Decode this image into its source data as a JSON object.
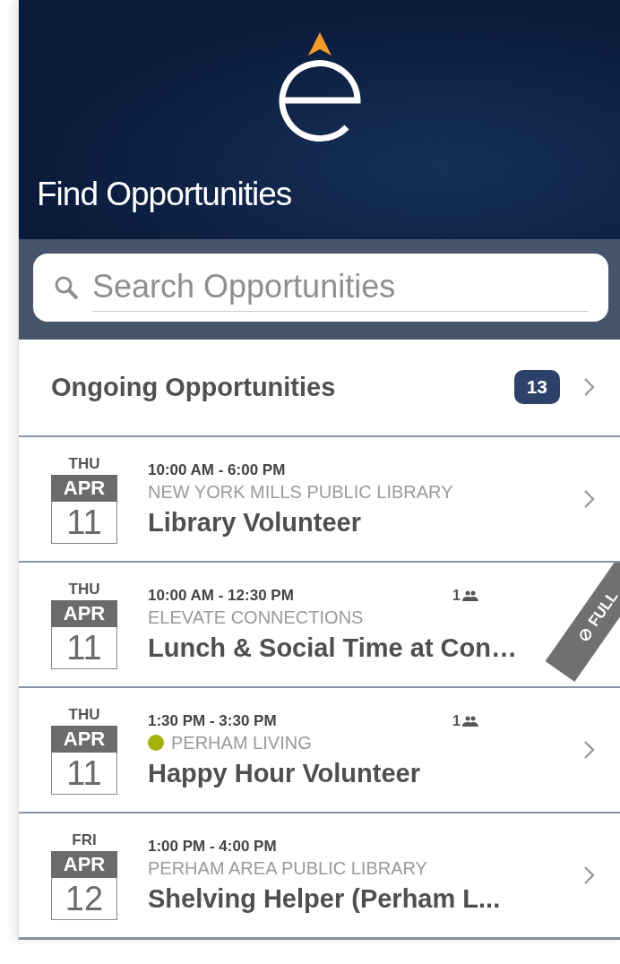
{
  "header": {
    "title": "Find Opportunities"
  },
  "search": {
    "placeholder": "Search Opportunities"
  },
  "ongoing": {
    "label": "Ongoing Opportunities",
    "count": "13"
  },
  "events": [
    {
      "day": "THU",
      "month": "APR",
      "date": "11",
      "time": "10:00 AM - 6:00 PM",
      "organization": "NEW YORK MILLS PUBLIC LIBRARY",
      "title": "Library Volunteer",
      "full": false
    },
    {
      "day": "THU",
      "month": "APR",
      "date": "11",
      "time": "10:00 AM - 12:30 PM",
      "attendees": "1",
      "organization": "ELEVATE CONNECTIONS",
      "title": "Lunch & Social Time at Con…",
      "full": true,
      "full_label": "FULL"
    },
    {
      "day": "THU",
      "month": "APR",
      "date": "11",
      "time": "1:30 PM - 3:30 PM",
      "attendees": "1",
      "organization": "PERHAM LIVING",
      "color": "#a4b10a",
      "title": "Happy Hour Volunteer",
      "full": false
    },
    {
      "day": "FRI",
      "month": "APR",
      "date": "12",
      "time": "1:00 PM - 4:00 PM",
      "organization": "PERHAM AREA PUBLIC LIBRARY",
      "title": "Shelving Helper (Perham L...",
      "full": false
    }
  ]
}
